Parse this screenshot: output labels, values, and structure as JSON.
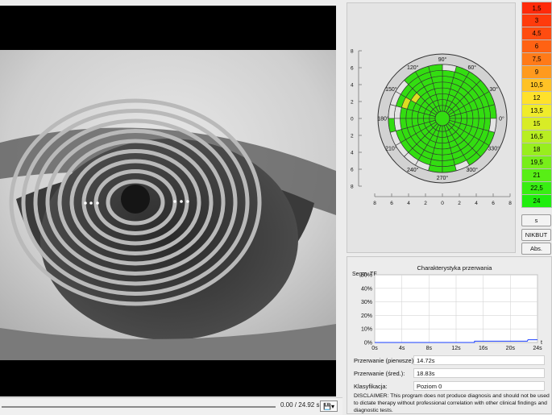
{
  "video": {
    "time_label": "0.00 / 24.92 s",
    "save_icon": "save-dropdown-icon",
    "progress": 0.0
  },
  "polar": {
    "y_ticks": [
      "8",
      "6",
      "4",
      "2",
      "0",
      "2",
      "4",
      "6",
      "8"
    ],
    "x_ticks": [
      "8",
      "6",
      "4",
      "2",
      "0",
      "2",
      "4",
      "6",
      "8"
    ],
    "angle_labels": [
      "0°",
      "30°",
      "60°",
      "90°",
      "120°",
      "150°",
      "180°",
      "210°",
      "240°",
      "270°",
      "300°",
      "330°"
    ],
    "fill_color": "#33dd11",
    "highlight_color": "#dddd22"
  },
  "legend": {
    "items": [
      {
        "label": "1,5",
        "color": "#ff2a0a"
      },
      {
        "label": "3",
        "color": "#ff3b0c"
      },
      {
        "label": "4,5",
        "color": "#ff4c10"
      },
      {
        "label": "6",
        "color": "#ff6213"
      },
      {
        "label": "7,5",
        "color": "#ff7a18"
      },
      {
        "label": "9",
        "color": "#ff9a1e"
      },
      {
        "label": "10,5",
        "color": "#ffc225"
      },
      {
        "label": "12",
        "color": "#ffe12b"
      },
      {
        "label": "13,5",
        "color": "#f0ec2a"
      },
      {
        "label": "15",
        "color": "#d8ec26"
      },
      {
        "label": "16,5",
        "color": "#b8ee22"
      },
      {
        "label": "18",
        "color": "#98ee1e"
      },
      {
        "label": "19,5",
        "color": "#78ee1a"
      },
      {
        "label": "21",
        "color": "#58ee16"
      },
      {
        "label": "22,5",
        "color": "#38ee12"
      },
      {
        "label": "24",
        "color": "#20ee0e"
      }
    ]
  },
  "side_buttons": {
    "s": "s",
    "nikbut": "NIKBUT",
    "abs": "Abs."
  },
  "chart": {
    "title": "Charakterystyka przerwania",
    "ylabel": "Segm. TF",
    "t_label": "t",
    "y_ticks": [
      "50%",
      "40%",
      "30%",
      "20%",
      "10%",
      "0%"
    ],
    "x_ticks": [
      "0s",
      "4s",
      "8s",
      "12s",
      "16s",
      "20s",
      "24s"
    ]
  },
  "chart_data": {
    "type": "line",
    "title": "Charakterystyka przerwania",
    "ylabel": "Segm. TF",
    "xlabel": "t",
    "xlim": [
      0,
      24
    ],
    "ylim": [
      0,
      50
    ],
    "x_tick_labels": [
      "0s",
      "4s",
      "8s",
      "12s",
      "16s",
      "20s",
      "24s"
    ],
    "y_tick_labels": [
      "0%",
      "10%",
      "20%",
      "30%",
      "40%",
      "50%"
    ],
    "x": [
      0,
      14.7,
      14.72,
      22.5,
      22.6,
      24.9
    ],
    "y": [
      0,
      0,
      1,
      1,
      2,
      2
    ]
  },
  "fields": {
    "first_label": "Przerwanie (pierwsze):",
    "first_value": "14.72s",
    "avg_label": "Przerwanie (śred.):",
    "avg_value": "18.83s",
    "class_label": "Klasyfikacja:",
    "class_value": "Poziom 0"
  },
  "disclaimer": "DISCLAIMER: This program does not produce diagnosis and should not be used to dictate therapy without professional correlation with other clinical findings and diagnostic tests."
}
